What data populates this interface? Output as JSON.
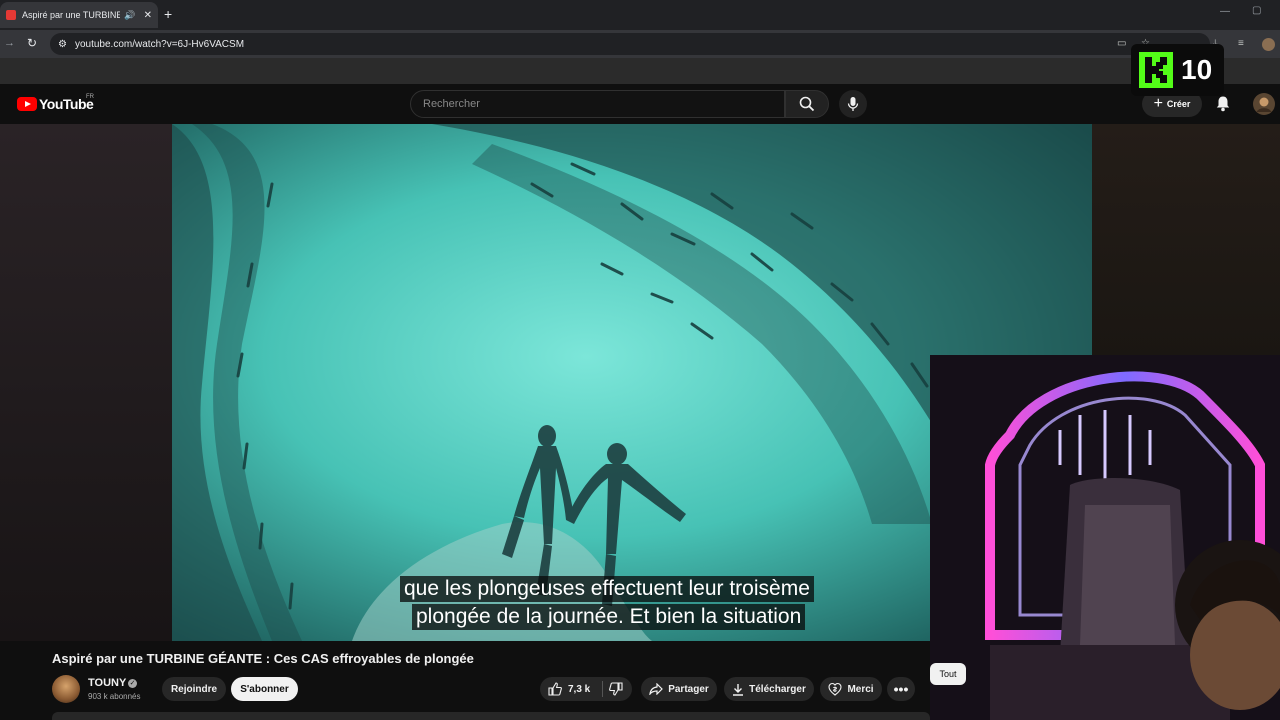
{
  "browser": {
    "tab_title": "Aspiré par une TURBINE GÉ",
    "tab_audio_icon": "speaker-icon",
    "tab_close": "✕",
    "new_tab": "+",
    "url": "youtube.com/watch?v=6J-Hv6VACSM",
    "window_minimize": "—",
    "window_maximize": "▢"
  },
  "youtube": {
    "brand": "YouTube",
    "country": "FR",
    "search_placeholder": "Rechercher",
    "create_label": "Créer"
  },
  "overlay_badge": {
    "number": "10",
    "brand_color": "#53fc18"
  },
  "video": {
    "captions": [
      "que les plongeuses effectuent leur troisème",
      "plongée de la journée. Et bien la situation"
    ],
    "title": "Aspiré par une TURBINE GÉANTE : Ces CAS effroyables de plongée"
  },
  "channel": {
    "name": "TOUNY",
    "subscribers": "903 k abonnés",
    "join_label": "Rejoindre",
    "subscribe_label": "S'abonner"
  },
  "actions": {
    "likes": "7,3 k",
    "share_label": "Partager",
    "download_label": "Télécharger",
    "thanks_label": "Merci",
    "more": "•••"
  },
  "chips": {
    "all_label": "Tout"
  },
  "colors": {
    "accent_red": "#ff0000",
    "background": "#0f0f0f",
    "water": "#49c7ba"
  }
}
